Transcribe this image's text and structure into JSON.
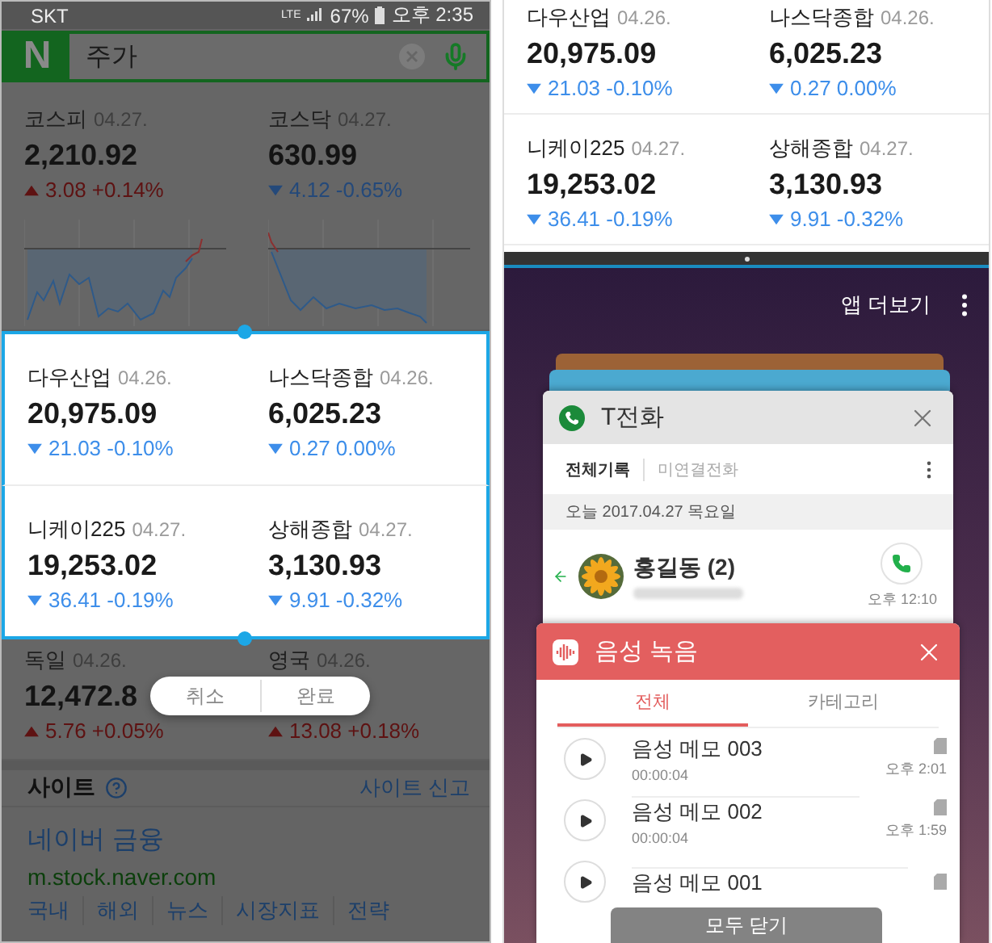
{
  "left_screen": {
    "status_bar": {
      "carrier": "SKT",
      "network": "LTE",
      "battery": "67%",
      "time": "오후 2:35"
    },
    "search": {
      "logo": "N",
      "value": "주가"
    },
    "index_rows": [
      {
        "kind": "chart",
        "selected": false,
        "items": [
          {
            "name": "코스피",
            "date": "04.27.",
            "value": "2,210.92",
            "kind": "up",
            "change": "3.08 +0.14%"
          },
          {
            "name": "코스닥",
            "date": "04.27.",
            "value": "630.99",
            "kind": "down",
            "change": "4.12 -0.65%"
          }
        ]
      },
      {
        "kind": "plain",
        "selected": true,
        "items": [
          {
            "name": "다우산업",
            "date": "04.26.",
            "value": "20,975.09",
            "kind": "down",
            "change": "21.03 -0.10%"
          },
          {
            "name": "나스닥종합",
            "date": "04.26.",
            "value": "6,025.23",
            "kind": "down",
            "change": "0.27 0.00%"
          }
        ]
      },
      {
        "kind": "plain",
        "selected": true,
        "items": [
          {
            "name": "니케이225",
            "date": "04.27.",
            "value": "19,253.02",
            "kind": "down",
            "change": "36.41 -0.19%"
          },
          {
            "name": "상해종합",
            "date": "04.27.",
            "value": "3,130.93",
            "kind": "down",
            "change": "9.91 -0.32%"
          }
        ]
      },
      {
        "kind": "plain",
        "selected": false,
        "items": [
          {
            "name": "독일",
            "date": "04.26.",
            "value": "12,472.8",
            "kind": "up",
            "change": "5.76 +0.05%"
          },
          {
            "name": "영국",
            "date": "04.26.",
            "kind": "up",
            "change": "13.08 +0.18%"
          }
        ]
      }
    ],
    "edit_actions": [
      "취소",
      "완료"
    ],
    "site": {
      "title": "사이트",
      "report": "사이트 신고",
      "name": "네이버 금융",
      "url": "m.stock.naver.com",
      "links": [
        "국내",
        "해외",
        "뉴스",
        "시장지표",
        "전략"
      ]
    }
  },
  "right_screen": {
    "index_rows": [
      {
        "items": [
          {
            "name": "다우산업",
            "date": "04.26.",
            "value": "20,975.09",
            "kind": "down",
            "change": "21.03 -0.10%"
          },
          {
            "name": "나스닥종합",
            "date": "04.26.",
            "value": "6,025.23",
            "kind": "down",
            "change": "0.27 0.00%"
          }
        ]
      },
      {
        "items": [
          {
            "name": "니케이225",
            "date": "04.27.",
            "value": "19,253.02",
            "kind": "down",
            "change": "36.41 -0.19%"
          },
          {
            "name": "상해종합",
            "date": "04.27.",
            "value": "3,130.93",
            "kind": "down",
            "change": "9.91 -0.32%"
          }
        ]
      }
    ],
    "recents": {
      "more_label": "앱 더보기",
      "close_all": "모두 닫기",
      "phone_app": {
        "title": "T전화",
        "tabs": [
          {
            "label": "전체기록",
            "selected": true
          },
          {
            "label": "미연결전화",
            "selected": false
          }
        ],
        "date_header": "오늘 2017.04.27 목요일",
        "calls": [
          {
            "name": "홍길동 (2)",
            "time": "오후 12:10"
          }
        ]
      },
      "recorder_app": {
        "title": "음성 녹음",
        "tabs": [
          {
            "label": "전체",
            "selected": true
          },
          {
            "label": "카테고리",
            "selected": false
          }
        ],
        "recordings": [
          {
            "title": "음성 메모 003",
            "duration": "00:00:04",
            "time": "오후 2:01"
          },
          {
            "title": "음성 메모 002",
            "duration": "00:00:04",
            "time": "오후 1:59"
          },
          {
            "title": "음성 메모 001"
          }
        ]
      }
    }
  }
}
